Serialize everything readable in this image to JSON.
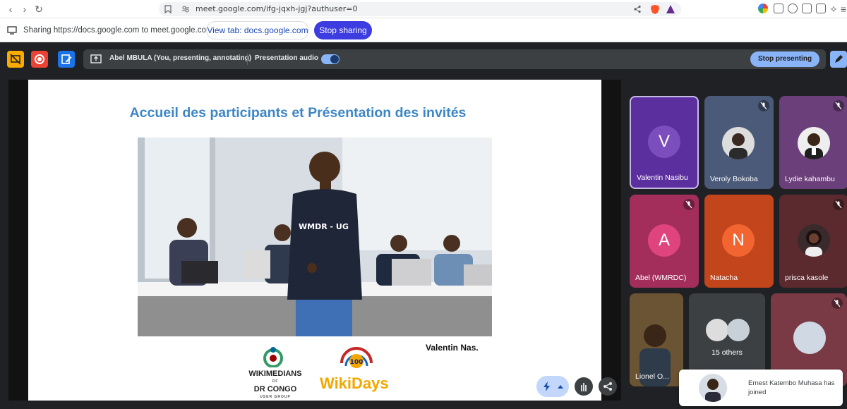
{
  "browser": {
    "url": "meet.google.com/ifg-jqxh-jgj?authuser=0"
  },
  "share_bar": {
    "text": "Sharing https://docs.google.com to meet.google.com",
    "view_tab_label": "View tab: docs.google.com",
    "stop_sharing_label": "Stop sharing"
  },
  "meet_top": {
    "presenter": "Abel MBULA (You, presenting, annotating)",
    "audio_label": "Presentation audio",
    "stop_presenting_label": "Stop presenting"
  },
  "slide": {
    "title": "Accueil des participants et Présentation des invités",
    "logo_text_line1": "WIKIMEDIANS",
    "logo_text_of": "OF",
    "logo_text_line2": "DR CONGO",
    "logo_text_line3": "USER GROUP",
    "wikidays": "WikiDays",
    "wikidays_badge": "100",
    "shirt_text": "WMDR - UG",
    "speaker_name": "Valentin Nas."
  },
  "participants": [
    {
      "name": "Valentin Nasibu",
      "initial": "V",
      "color": "#7c4dbd",
      "bg": "#5b2f9e",
      "highlight": true
    },
    {
      "name": "Veroly Bokoba",
      "bg": "#4a5a78",
      "muted": true
    },
    {
      "name": "Lydie kahambu",
      "bg": "#6b3f7a",
      "muted": true
    },
    {
      "name": "Abel (WMRDC)",
      "initial": "A",
      "color": "#e0447e",
      "bg": "#a32e5c",
      "muted": true
    },
    {
      "name": "Natacha",
      "initial": "N",
      "color": "#f26430",
      "bg": "#c2451c"
    },
    {
      "name": "prisca kasole",
      "bg": "#5a2a2f",
      "muted": true
    },
    {
      "name": "Lionel O...",
      "bg": "#5f4a2a",
      "muted": true
    },
    {
      "name": "15 others",
      "bg": "#3c4043"
    },
    {
      "name": "",
      "bg": "#7a3a45",
      "muted": true
    }
  ],
  "toast": {
    "text": "Ernest Katembo Muhasa has joined"
  },
  "icons": [
    "back-icon",
    "forward-icon",
    "reload-icon",
    "bookmark-icon",
    "site-settings-icon",
    "share-icon",
    "brave-icon",
    "screen-share-icon",
    "record-icon",
    "annotate-icon",
    "present-icon",
    "volume-icon",
    "pen-icon",
    "mic-off-icon",
    "lightning-icon",
    "hand-icon",
    "share-node-icon"
  ]
}
